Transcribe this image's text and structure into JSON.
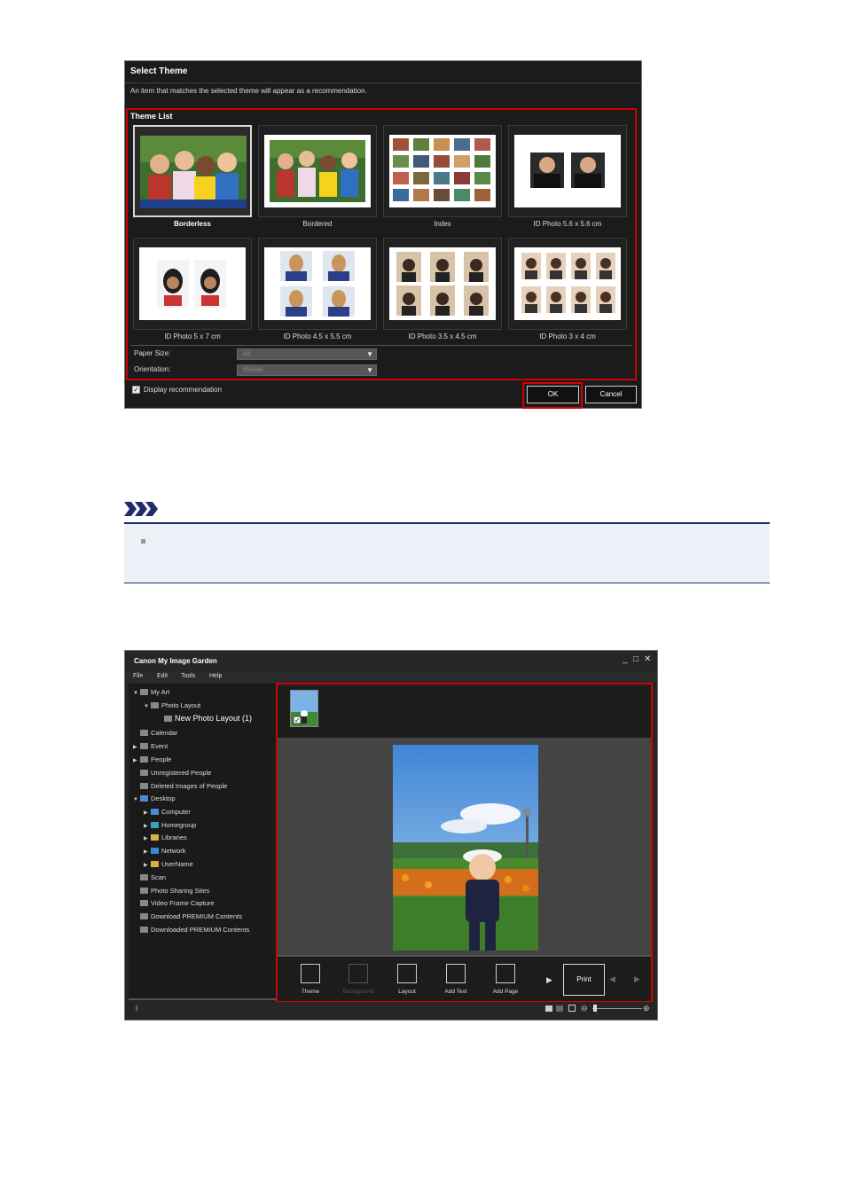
{
  "dialog": {
    "title": "Select Theme",
    "description": "An item that matches the selected theme will appear as a recommendation.",
    "theme_list_label": "Theme List",
    "themes": [
      {
        "label": "Borderless"
      },
      {
        "label": "Bordered"
      },
      {
        "label": "Index"
      },
      {
        "label": "ID Photo 5.6 x 5.6 cm"
      },
      {
        "label": "ID Photo 5 x 7 cm"
      },
      {
        "label": "ID Photo 4.5 x 5.5 cm"
      },
      {
        "label": "ID Photo 3.5 x 4.5 cm"
      },
      {
        "label": "ID Photo 3 x 4 cm"
      }
    ],
    "paper_size_label": "Paper Size:",
    "orientation_label": "Orientation:",
    "paper_size_value": "A4",
    "orientation_value": "Portrait",
    "display_recommendation_label": "Display recommendation",
    "display_recommendation_checked": true,
    "ok_label": "OK",
    "cancel_label": "Cancel",
    "highlight_color": "#d40000"
  },
  "note": {
    "accent": "#1f2c6a"
  },
  "app": {
    "title": "Canon My Image Garden",
    "window_controls": [
      "_",
      "□",
      "✕"
    ],
    "menu": [
      "File",
      "Edit",
      "Tools",
      "Help"
    ],
    "tree": [
      {
        "label": "My Art"
      },
      {
        "label": "Photo Layout"
      },
      {
        "label": "New Photo Layout (1)"
      },
      {
        "label": "Calendar"
      },
      {
        "label": "Event"
      },
      {
        "label": "People"
      },
      {
        "label": "Unregistered People"
      },
      {
        "label": "Deleted Images of People"
      },
      {
        "label": "Desktop"
      },
      {
        "label": "Computer"
      },
      {
        "label": "Homegroup"
      },
      {
        "label": "Libraries"
      },
      {
        "label": "Network"
      },
      {
        "label": "UserName"
      },
      {
        "label": "Scan"
      },
      {
        "label": "Photo Sharing Sites"
      },
      {
        "label": "Video Frame Capture"
      },
      {
        "label": "Download PREMIUM Contents"
      },
      {
        "label": "Downloaded PREMIUM Contents"
      }
    ],
    "tools": [
      {
        "label": "Theme",
        "icon": "theme-icon"
      },
      {
        "label": "Background",
        "icon": "background-icon"
      },
      {
        "label": "Layout",
        "icon": "layout-icon"
      },
      {
        "label": "Add Text",
        "icon": "add-text-icon"
      },
      {
        "label": "Add Page",
        "icon": "add-page-icon"
      }
    ],
    "print_label": "Print"
  }
}
